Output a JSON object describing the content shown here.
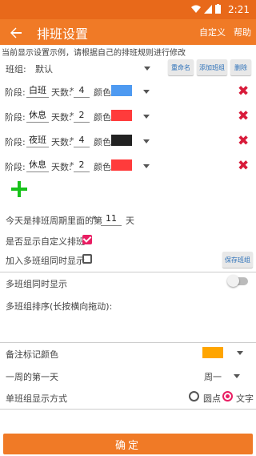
{
  "status": {
    "time": "2:21"
  },
  "toolbar": {
    "back_icon": "arrow-left-icon",
    "title": "排班设置",
    "custom": "自定义",
    "help": "帮助"
  },
  "hint": "当前显示设置示例，请根据自己的排班规则进行修改",
  "group": {
    "label": "班组:",
    "value": "默认",
    "rename": "重命名",
    "add": "添加班组",
    "delete": "删除"
  },
  "stage_label": "阶段:",
  "days_label": "天数:",
  "color_label": "颜色:",
  "stages": [
    {
      "name": "白班",
      "days": "4",
      "color": "#4e9af1"
    },
    {
      "name": "休息",
      "days": "2",
      "color": "#ff3b3b"
    },
    {
      "name": "夜班",
      "days": "4",
      "color": "#222222"
    },
    {
      "name": "休息",
      "days": "2",
      "color": "#ff3b3b"
    }
  ],
  "cycle": {
    "prefix": "今天是排班周期里面的第",
    "value": "11",
    "suffix": "天"
  },
  "show_custom": {
    "label": "是否显示自定义排班",
    "checked": true
  },
  "add_multi": {
    "label": "加入多班组同时显示",
    "checked": false,
    "save": "保存班组"
  },
  "multi_show": {
    "label": "多班组同时显示",
    "on": false
  },
  "multi_sort": {
    "label": "多班组排序(长按横向拖动):"
  },
  "note_color": {
    "label": "备注标记颜色",
    "color": "#ffa500"
  },
  "week_start": {
    "label": "一周的第一天",
    "value": "周一"
  },
  "display_mode": {
    "label": "单班组显示方式",
    "option_dot": "圆点",
    "option_text": "文字",
    "selected": "文字"
  },
  "confirm": "确定"
}
